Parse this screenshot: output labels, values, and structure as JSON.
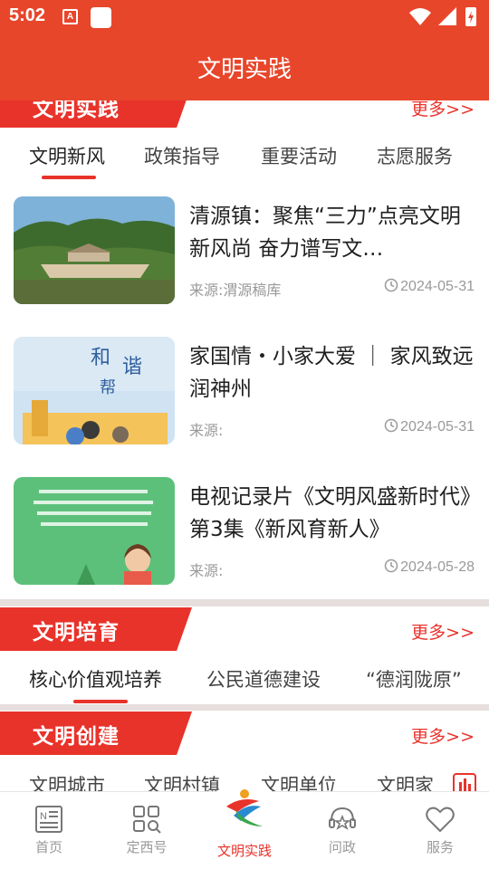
{
  "status": {
    "time": "5:02"
  },
  "header": {
    "title": "文明实践"
  },
  "section1": {
    "title": "文明实践",
    "more": "更多>>",
    "tabs": [
      {
        "label": "文明新风",
        "active": true
      },
      {
        "label": "政策指导",
        "active": false
      },
      {
        "label": "重要活动",
        "active": false
      },
      {
        "label": "志愿服务",
        "active": false
      }
    ],
    "news": [
      {
        "title": "清源镇：聚焦“三力”点亮文明新风尚 奋力谱写文…",
        "source": "来源:渭源稿库",
        "date": "2024-05-31",
        "thumb": "landscape-photo"
      },
      {
        "title": "家国情・小家大爱 ｜ 家风致远润神州",
        "source": "来源:",
        "date": "2024-05-31",
        "thumb": "family-illustration"
      },
      {
        "title": "电视记录片《文明风盛新时代》第3集《新风育新人》",
        "source": "来源:",
        "date": "2024-05-28",
        "thumb": "green-poster"
      }
    ]
  },
  "section2": {
    "title": "文明培育",
    "more": "更多>>",
    "tabs": [
      {
        "label": "核心价值观培养",
        "active": true
      },
      {
        "label": "公民道德建设",
        "active": false
      },
      {
        "label": "“德润陇原”",
        "active": false
      }
    ]
  },
  "section3": {
    "title": "文明创建",
    "more": "更多>>",
    "tabs": [
      {
        "label": "文明城市",
        "active": false
      },
      {
        "label": "文明村镇",
        "active": false
      },
      {
        "label": "文明单位",
        "active": false
      },
      {
        "label": "文明家",
        "active": false
      }
    ]
  },
  "nav": [
    {
      "label": "首页",
      "icon": "newspaper-icon",
      "active": false
    },
    {
      "label": "定西号",
      "icon": "grid-search-icon",
      "active": false
    },
    {
      "label": "文明实践",
      "icon": "civilization-logo-icon",
      "active": true
    },
    {
      "label": "问政",
      "icon": "headset-star-icon",
      "active": false
    },
    {
      "label": "服务",
      "icon": "heart-icon",
      "active": false
    }
  ],
  "colors": {
    "brand": "#e8462b",
    "accent": "#e8332b"
  }
}
